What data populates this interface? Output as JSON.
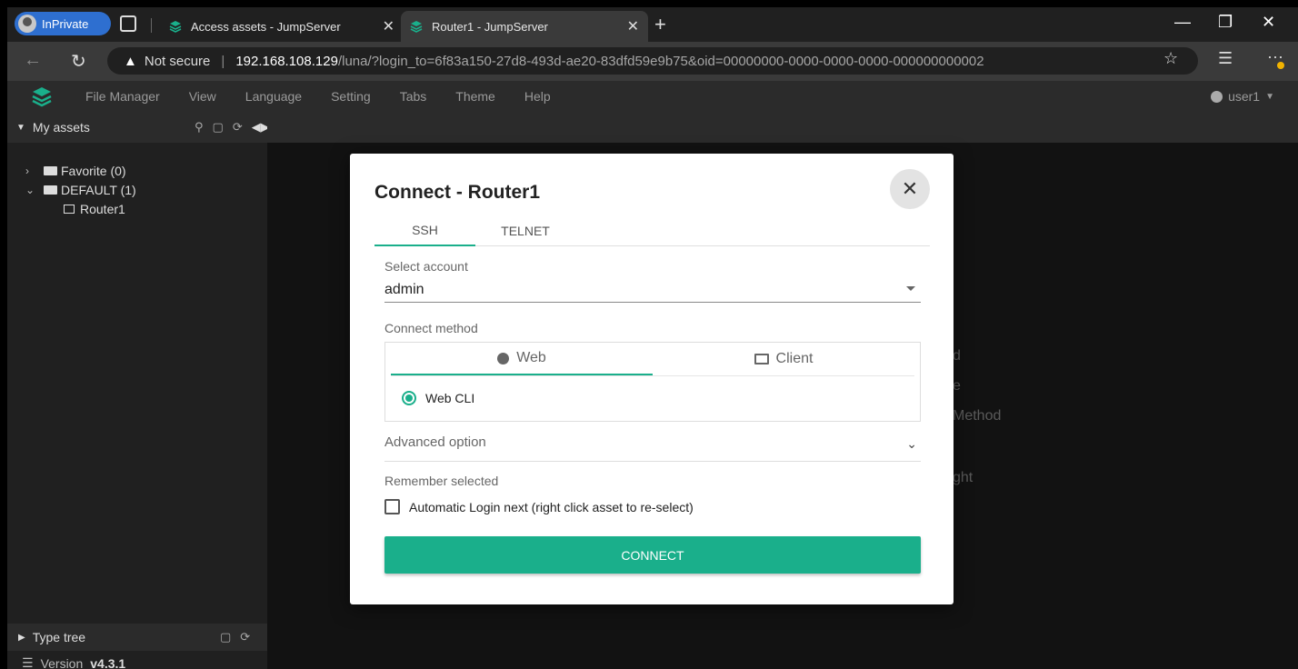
{
  "browser": {
    "inprivate_label": "InPrivate",
    "tabs": [
      {
        "title": "Access assets - JumpServer",
        "active": false
      },
      {
        "title": "Router1 - JumpServer",
        "active": true
      }
    ],
    "new_tab": "+",
    "security_label": "Not secure",
    "url_host": "192.168.108.129",
    "url_path": "/luna/?login_to=6f83a150-27d8-493d-ae20-83dfd59e9b75&oid=00000000-0000-0000-0000-000000000002"
  },
  "menubar": {
    "items": [
      "File Manager",
      "View",
      "Language",
      "Setting",
      "Tabs",
      "Theme",
      "Help"
    ],
    "user": "user1"
  },
  "sidebar": {
    "header": "My assets",
    "tree": [
      {
        "label": "Favorite (0)",
        "expanded": false
      },
      {
        "label": "DEFAULT (1)",
        "expanded": true,
        "children": [
          "Router1"
        ]
      }
    ],
    "type_tree": "Type tree",
    "version_label": "Version",
    "version": "v4.3.1"
  },
  "background_hints": [
    "d",
    "e",
    "Method",
    "ght"
  ],
  "modal": {
    "title": "Connect - Router1",
    "protocol_tabs": [
      "SSH",
      "TELNET"
    ],
    "active_protocol": "SSH",
    "select_account_label": "Select account",
    "selected_account": "admin",
    "connect_method_label": "Connect method",
    "method_tabs": [
      "Web",
      "Client"
    ],
    "active_method": "Web",
    "method_option": "Web CLI",
    "advanced_option": "Advanced option",
    "remember_label": "Remember selected",
    "auto_login": "Automatic Login next (right click asset to re-select)",
    "auto_login_checked": false,
    "connect_button": "CONNECT"
  },
  "colors": {
    "accent": "#1aaf8b",
    "inprivate": "#2e6fd0"
  }
}
